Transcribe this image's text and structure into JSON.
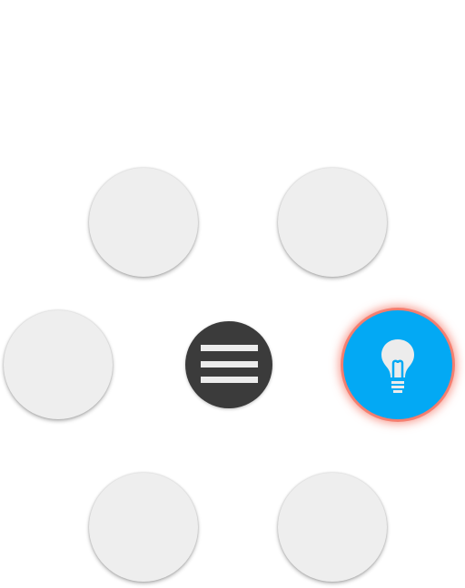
{
  "menu": {
    "toggle_icon": "hamburger-menu-icon",
    "items": [
      {
        "name": "menu-item-top-left",
        "icon": "none",
        "filled": false
      },
      {
        "name": "menu-item-top-right",
        "icon": "none",
        "filled": false
      },
      {
        "name": "menu-item-left",
        "icon": "none",
        "filled": false
      },
      {
        "name": "menu-item-right",
        "icon": "lightbulb-icon",
        "filled": true
      },
      {
        "name": "menu-item-bottom-left",
        "icon": "none",
        "filled": false
      },
      {
        "name": "menu-item-bottom-right",
        "icon": "none",
        "filled": false
      }
    ]
  },
  "colors": {
    "background": "#ffffff",
    "item_fill": "#eeeeee",
    "toggle_fill": "#3b3b3b",
    "accent": "#03a9f4",
    "highlight_glow": "#f0503c",
    "icon_fill": "#ececec"
  }
}
